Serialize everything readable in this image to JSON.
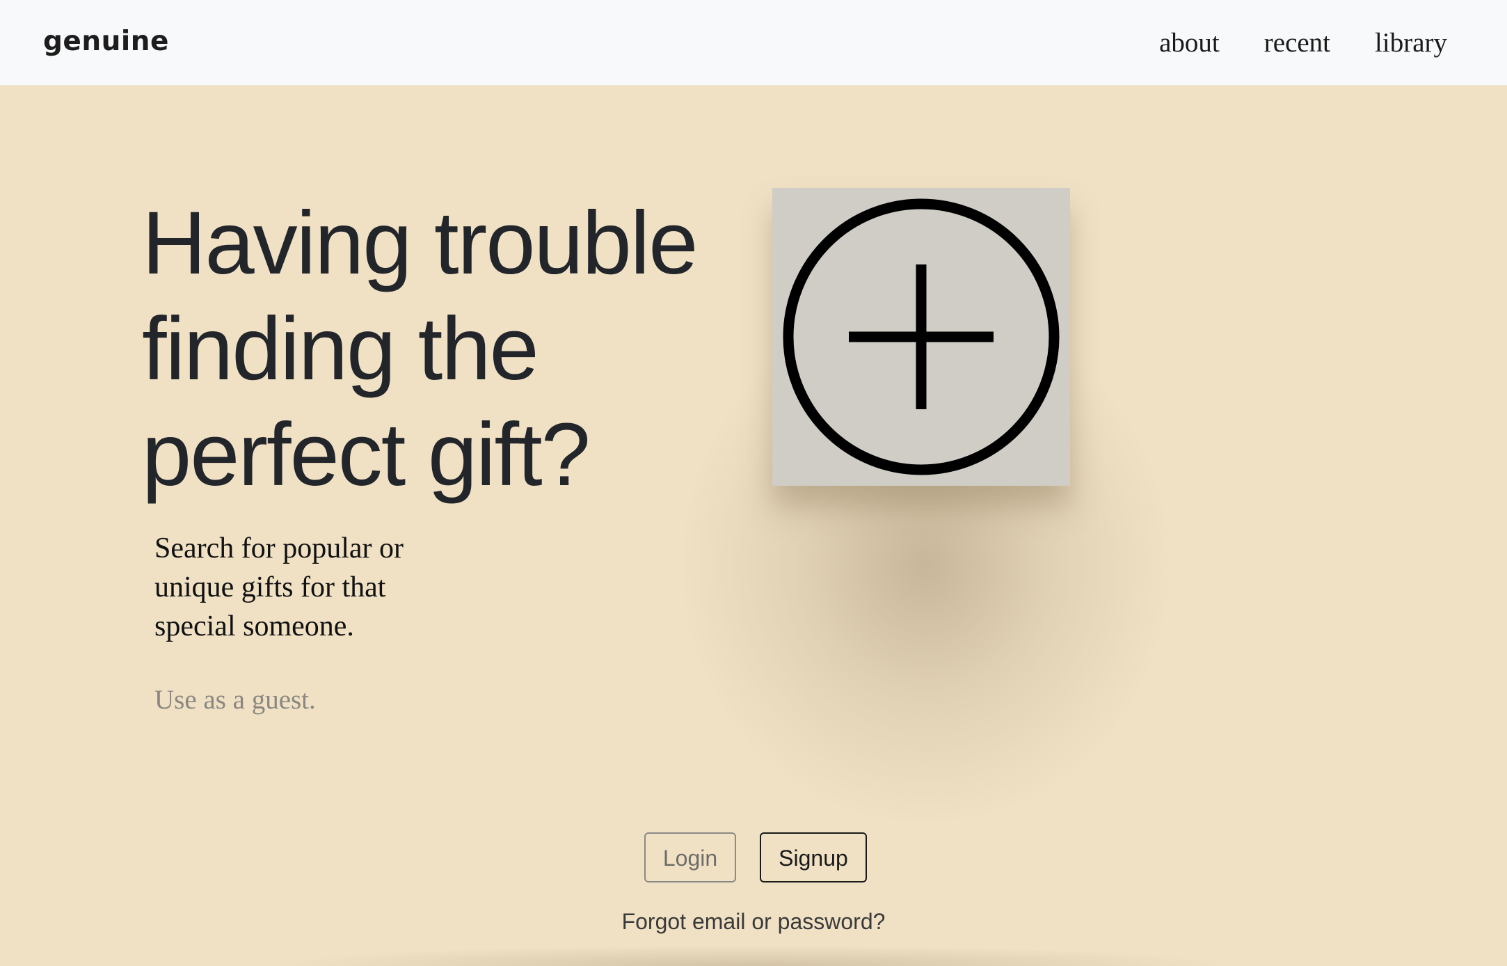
{
  "navbar": {
    "brand": "genuine",
    "links": [
      "about",
      "recent",
      "library"
    ]
  },
  "hero": {
    "headline": "Having trouble finding the perfect gift?",
    "subtext": "Search for popular or unique gifts for that special someone.",
    "guest_link": "Use as a guest."
  },
  "add_tile": {
    "icon": "plus-circle-icon"
  },
  "auth": {
    "login_label": "Login",
    "signup_label": "Signup",
    "forgot_label": "Forgot email or password?"
  },
  "colors": {
    "background": "#f0e1c5",
    "navbar": "#f8f9fa",
    "tile": "#cfcdc6",
    "text": "#212529",
    "muted": "#8a8780"
  }
}
